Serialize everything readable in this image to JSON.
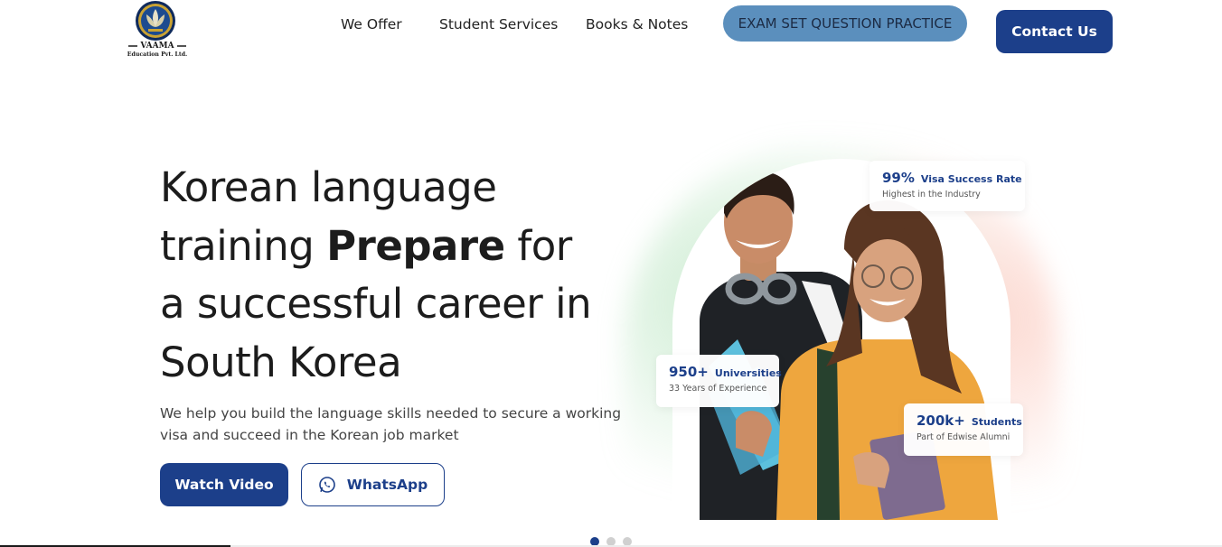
{
  "brand": {
    "name": "VAAMA",
    "tagline": "Education Pvt. Ltd.",
    "accent": "#1c3f8a",
    "exam_button_color": "#5b8fbd"
  },
  "nav": {
    "items": [
      {
        "label": "We Offer"
      },
      {
        "label": "Student Services"
      },
      {
        "label": "Books & Notes"
      }
    ],
    "exam_button": "EXAM SET QUESTION PRACTICE",
    "contact_button": "Contact Us"
  },
  "hero": {
    "title_part1": "Korean language training ",
    "title_bold": "Prepare",
    "title_part2": " for a successful career in South Korea",
    "subtitle": "We help you build the language skills needed to secure a working visa and succeed in the Korean job market",
    "watch_button": "Watch Video",
    "whatsapp_button": "WhatsApp",
    "whatsapp_icon": "whatsapp-icon"
  },
  "stats": [
    {
      "number": "99%",
      "label": "Visa Success Rate",
      "sub": "Highest in the Industry"
    },
    {
      "number": "950+",
      "label": "Universities",
      "sub": "33 Years of Experience"
    },
    {
      "number": "200k+",
      "label": "Students",
      "sub": "Part of Edwise Alumni"
    }
  ],
  "carousel": {
    "slides": 3,
    "active_index": 0
  }
}
